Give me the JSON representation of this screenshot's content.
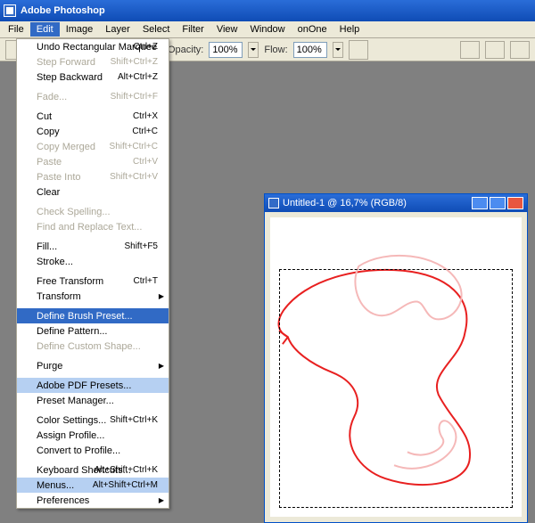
{
  "app": {
    "title": "Adobe Photoshop"
  },
  "menubar": {
    "items": [
      "File",
      "Edit",
      "Image",
      "Layer",
      "Select",
      "Filter",
      "View",
      "Window",
      "onOne",
      "Help"
    ],
    "open_index": 1
  },
  "optbar": {
    "opacity_label": "Opacity:",
    "opacity_value": "100%",
    "flow_label": "Flow:",
    "flow_value": "100%"
  },
  "document": {
    "title": "Untitled-1 @ 16,7% (RGB/8)"
  },
  "editmenu": {
    "items": [
      {
        "label": "Undo Rectangular Marquee",
        "shortcut": "Ctrl+Z",
        "enabled": true
      },
      {
        "label": "Step Forward",
        "shortcut": "Shift+Ctrl+Z",
        "enabled": false
      },
      {
        "label": "Step Backward",
        "shortcut": "Alt+Ctrl+Z",
        "enabled": true
      },
      {
        "sep": true
      },
      {
        "label": "Fade...",
        "shortcut": "Shift+Ctrl+F",
        "enabled": false
      },
      {
        "sep": true
      },
      {
        "label": "Cut",
        "shortcut": "Ctrl+X",
        "enabled": true
      },
      {
        "label": "Copy",
        "shortcut": "Ctrl+C",
        "enabled": true
      },
      {
        "label": "Copy Merged",
        "shortcut": "Shift+Ctrl+C",
        "enabled": false
      },
      {
        "label": "Paste",
        "shortcut": "Ctrl+V",
        "enabled": false
      },
      {
        "label": "Paste Into",
        "shortcut": "Shift+Ctrl+V",
        "enabled": false
      },
      {
        "label": "Clear",
        "shortcut": "",
        "enabled": true
      },
      {
        "sep": true
      },
      {
        "label": "Check Spelling...",
        "shortcut": "",
        "enabled": false
      },
      {
        "label": "Find and Replace Text...",
        "shortcut": "",
        "enabled": false
      },
      {
        "sep": true
      },
      {
        "label": "Fill...",
        "shortcut": "Shift+F5",
        "enabled": true
      },
      {
        "label": "Stroke...",
        "shortcut": "",
        "enabled": true
      },
      {
        "sep": true
      },
      {
        "label": "Free Transform",
        "shortcut": "Ctrl+T",
        "enabled": true
      },
      {
        "label": "Transform",
        "shortcut": "",
        "enabled": true,
        "submenu": true
      },
      {
        "sep": true
      },
      {
        "label": "Define Brush Preset...",
        "shortcut": "",
        "enabled": true,
        "highlight": "sel"
      },
      {
        "label": "Define Pattern...",
        "shortcut": "",
        "enabled": true
      },
      {
        "label": "Define Custom Shape...",
        "shortcut": "",
        "enabled": false
      },
      {
        "sep": true
      },
      {
        "label": "Purge",
        "shortcut": "",
        "enabled": true,
        "submenu": true
      },
      {
        "sep": true
      },
      {
        "label": "Adobe PDF Presets...",
        "shortcut": "",
        "enabled": true,
        "highlight": "soft"
      },
      {
        "label": "Preset Manager...",
        "shortcut": "",
        "enabled": true
      },
      {
        "sep": true
      },
      {
        "label": "Color Settings...",
        "shortcut": "Shift+Ctrl+K",
        "enabled": true
      },
      {
        "label": "Assign Profile...",
        "shortcut": "",
        "enabled": true
      },
      {
        "label": "Convert to Profile...",
        "shortcut": "",
        "enabled": true
      },
      {
        "sep": true
      },
      {
        "label": "Keyboard Shortcuts...",
        "shortcut": "Alt+Shift+Ctrl+K",
        "enabled": true
      },
      {
        "label": "Menus...",
        "shortcut": "Alt+Shift+Ctrl+M",
        "enabled": true,
        "highlight": "soft"
      },
      {
        "label": "Preferences",
        "shortcut": "",
        "enabled": true,
        "submenu": true
      }
    ]
  }
}
